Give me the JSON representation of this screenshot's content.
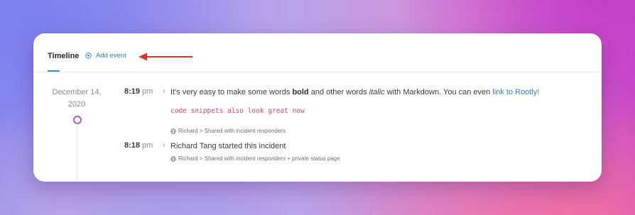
{
  "tabs": {
    "timeline": "Timeline",
    "add_event": "Add event"
  },
  "date": {
    "line1": "December 14,",
    "line2": "2020"
  },
  "events": [
    {
      "time": "8:19",
      "ampm": "pm",
      "text_parts": {
        "p1": "It's very easy to make some words ",
        "bold": "bold",
        "p2": " and other words ",
        "italic": "italic",
        "p3": " with Markdown. You can even ",
        "link": "link to Rootly!"
      },
      "code": "code snippets also look great now",
      "meta": "Richard > Shared with incident responders"
    },
    {
      "time": "8:18",
      "ampm": "pm",
      "text": "Richard Tang started this incident",
      "meta": "Richard > Shared with incident responders + private status page"
    }
  ],
  "icons": {
    "add": "plus-circle-icon",
    "chevron": "chevron-right-icon",
    "visibility": "globe-icon",
    "annotation": "red-arrow-icon"
  },
  "colors": {
    "accent": "#2f7fcf",
    "code": "#d0457a",
    "timeline_dot": "#b45ab6",
    "arrow": "#e0342c"
  }
}
